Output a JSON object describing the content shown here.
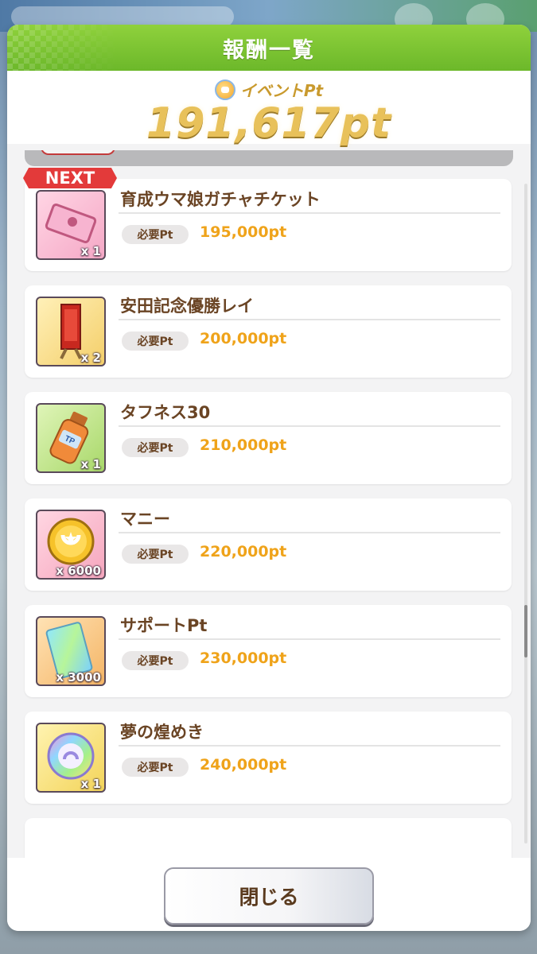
{
  "header": {
    "title": "報酬一覧"
  },
  "points": {
    "label": "イベントPt",
    "value": "191,617pt"
  },
  "next_badge": "NEXT",
  "rewards": [
    {
      "name": "育成ウマ娘ガチャチケット",
      "qty": "x 1",
      "req_label": "必要Pt",
      "req_value": "195,000pt",
      "icon": "gacha-ticket-icon"
    },
    {
      "name": "安田記念優勝レイ",
      "qty": "x 2",
      "req_label": "必要Pt",
      "req_value": "200,000pt",
      "icon": "victory-lei-icon"
    },
    {
      "name": "タフネス30",
      "qty": "x 1",
      "req_label": "必要Pt",
      "req_value": "210,000pt",
      "icon": "tp-bottle-icon"
    },
    {
      "name": "マニー",
      "qty": "x 6000",
      "req_label": "必要Pt",
      "req_value": "220,000pt",
      "icon": "money-coin-icon"
    },
    {
      "name": "サポートPt",
      "qty": "x 3000",
      "req_label": "必要Pt",
      "req_value": "230,000pt",
      "icon": "support-pt-card-icon"
    },
    {
      "name": "夢の煌めき",
      "qty": "x 1",
      "req_label": "必要Pt",
      "req_value": "240,000pt",
      "icon": "dream-sparkle-icon"
    }
  ],
  "footer": {
    "close_label": "閉じる"
  }
}
